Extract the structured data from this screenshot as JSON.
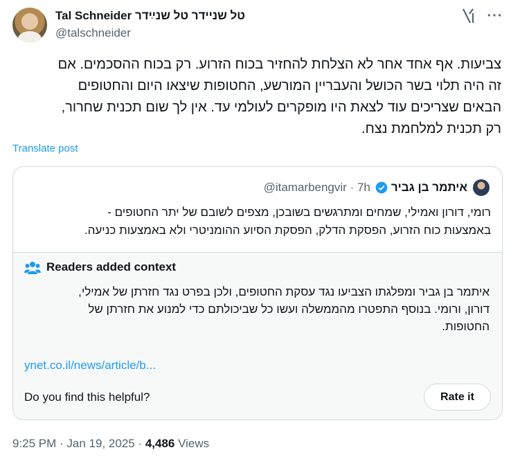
{
  "author": {
    "name": "Tal Schneider טל שניידר טל שנײַדר",
    "handle": "@talschneider"
  },
  "post": {
    "lines": [
      "צביעות. אף אחד אחר לא הצלחת להחזיר בכוח הזרוע. רק בכוח ההסכמים. אם",
      "זה היה תלוי בשר הכושל והעבריין המורשע, החטופות שיצאו היום והחטופים",
      "הבאים שצריכים עוד לצאת היו מופקרים לעולמי עד. אין לך שום תכנית שחרור,",
      "רק תכנית למלחמת נצח."
    ],
    "translate_label": "Translate post"
  },
  "quote": {
    "name": "איתמר בן גביר",
    "handle": "@itamarbengvir",
    "time": "· 7h",
    "lines": [
      "רומי, דורון ואמילי, שמחים ומתרגשים בשובכן, מצפים לשובם של יתר החטופים -",
      "באמצעות כוח הזרוע, הפסקת הדלק, הפסקת הסיוע ההומניטרי ולא באמצעות כניעה."
    ]
  },
  "context": {
    "title": "Readers added context",
    "lines": [
      "איתמר בן גביר ומפלגתו הצביעו נגד עסקת החטופים, ולכן בפרט נגד חזרתן של אמילי,",
      "דורון, ורומי. בנוסף התפטרו מהממשלה ועשו כל שביכולתם כדי למנוע את חזרתן של",
      "החטופות."
    ],
    "link": "ynet.co.il/news/article/b...",
    "helpful_question": "Do you find this helpful?",
    "rate_label": "Rate it"
  },
  "meta": {
    "time": "9:25 PM",
    "sep1": " · ",
    "date": "Jan 19, 2025",
    "sep2": " · ",
    "views_count": "4,486",
    "views_label": " Views"
  },
  "colors": {
    "accent": "#1d9bf0",
    "verified": "#1d9bf0",
    "secondary_text": "#536471"
  },
  "icons": {
    "grok": "grok-icon",
    "more": "more-icon",
    "verified": "verified-badge-icon",
    "readers": "people-icon"
  }
}
